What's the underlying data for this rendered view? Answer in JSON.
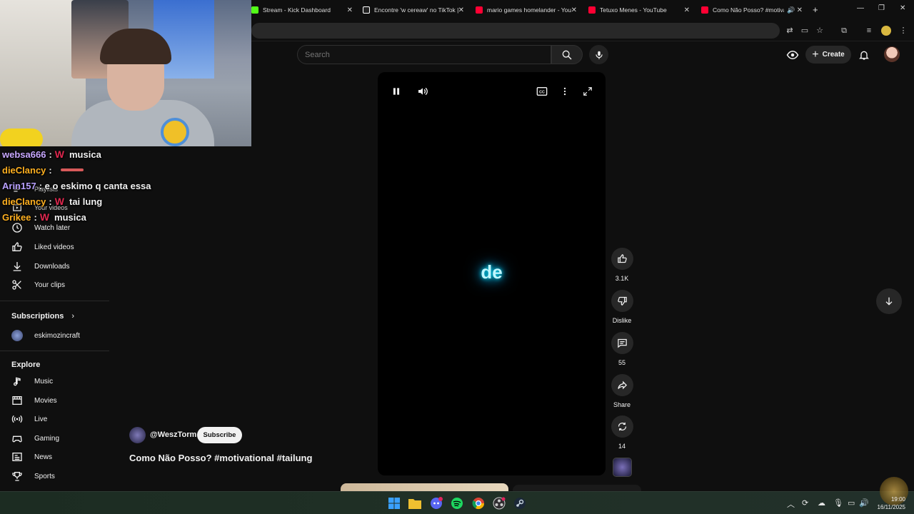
{
  "browser": {
    "tabs": [
      {
        "title": "Stream - Kick Dashboard",
        "favicon_color": "#53fc18"
      },
      {
        "title": "Encontre 'w cereaw' no TikTok |",
        "favicon_color": "#ffffff"
      },
      {
        "title": "mario games homelander - You",
        "favicon_color": "#ff0033"
      },
      {
        "title": "Tetuxo Menes - YouTube",
        "favicon_color": "#ff0033"
      },
      {
        "title": "Como Não Posso? #motiva",
        "favicon_color": "#ff0033"
      }
    ],
    "close_glyph": "✕",
    "new_tab_glyph": "+"
  },
  "chat": [
    {
      "user": "websa666",
      "color": "#c8a8ff",
      "emote": "W",
      "message": "musica"
    },
    {
      "user": "dieClancy",
      "color": "#ffb020",
      "emote": "",
      "message": ""
    },
    {
      "user": "Arin157",
      "color": "#b8a0ff",
      "emote": "",
      "message": "e o eskimo q canta essa"
    },
    {
      "user": "dieClancy",
      "color": "#ffb020",
      "emote": "W",
      "message": "tai lung"
    },
    {
      "user": "Grikee",
      "color": "#ffb020",
      "emote": "W",
      "message": "musica"
    }
  ],
  "youtube": {
    "search_placeholder": "Search",
    "create_label": "Create",
    "sidebar": {
      "partial_items": [
        "Playlists",
        "Your videos"
      ],
      "items": [
        {
          "label": "Watch later",
          "icon": "clock-icon"
        },
        {
          "label": "Liked videos",
          "icon": "thumbs-up-icon"
        },
        {
          "label": "Downloads",
          "icon": "download-icon"
        },
        {
          "label": "Your clips",
          "icon": "scissors-icon"
        }
      ],
      "subscriptions_heading": "Subscriptions",
      "subscriptions": [
        {
          "label": "eskimozincraft"
        }
      ],
      "explore_heading": "Explore",
      "explore": [
        {
          "label": "Music",
          "icon": "music-note-icon"
        },
        {
          "label": "Movies",
          "icon": "film-icon"
        },
        {
          "label": "Live",
          "icon": "live-icon"
        },
        {
          "label": "Gaming",
          "icon": "gamepad-icon"
        },
        {
          "label": "News",
          "icon": "news-icon"
        },
        {
          "label": "Sports",
          "icon": "trophy-icon"
        }
      ]
    },
    "short": {
      "caption_word": "de",
      "channel": "@WeszTorm",
      "subscribe_label": "Subscribe",
      "title": "Como Não Posso? #motivational #tailung",
      "actions": {
        "likes": "3.1K",
        "dislike": "Dislike",
        "comments": "55",
        "share": "Share",
        "remix": "14"
      }
    }
  },
  "taskbar": {
    "time": "19:00",
    "date": "16/11/2025"
  }
}
